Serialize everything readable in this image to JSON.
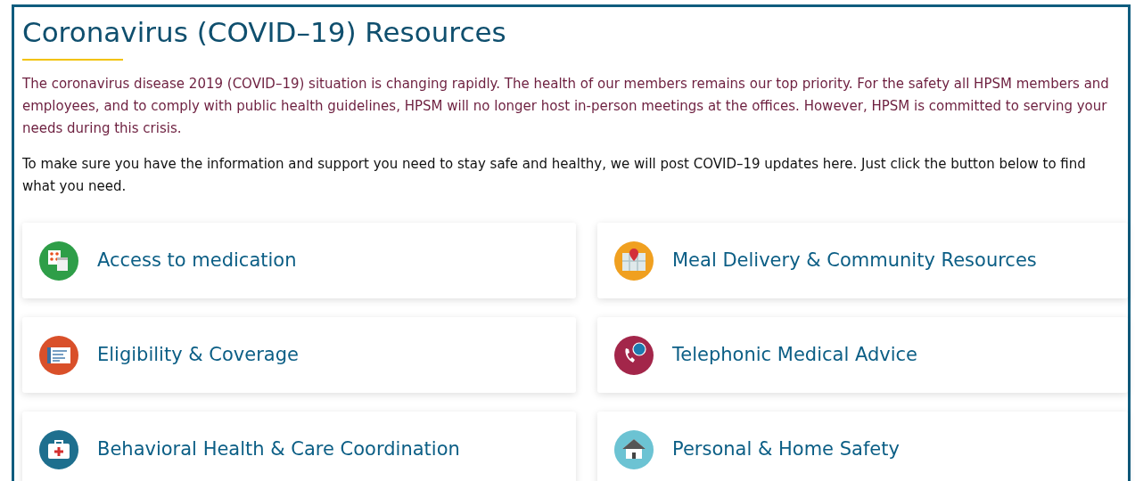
{
  "title": "Coronavirus (COVID–19) Resources",
  "paragraphs": [
    {
      "kind": "notice",
      "text": "The coronavirus disease 2019 (COVID–19) situation is changing rapidly. The health of our members remains our top priority. For the safety all HPSM members and employees, and to comply with public health guidelines, HPSM will no longer host in-person meetings at the offices. However, HPSM is committed to serving your needs during this crisis."
    },
    {
      "kind": "plain",
      "text": "To make sure you have the information and support you need to stay safe and healthy, we will post COVID–19 updates here. Just click the button below to find what you need."
    }
  ],
  "resources": [
    {
      "label": "Access to medication",
      "kind": "medication",
      "color": "#2e9e48"
    },
    {
      "label": "Meal Delivery & Community Resources",
      "kind": "map",
      "color": "#f0a020"
    },
    {
      "label": "Eligibility & Coverage",
      "kind": "card",
      "color": "#d9502a"
    },
    {
      "label": "Telephonic Medical Advice",
      "kind": "phone",
      "color": "#a3264a"
    },
    {
      "label": "Behavioral Health & Care Coordination",
      "kind": "medkit",
      "color": "#1e6f8e"
    },
    {
      "label": "Personal & Home Safety",
      "kind": "house",
      "color": "#6cc3d3"
    }
  ]
}
